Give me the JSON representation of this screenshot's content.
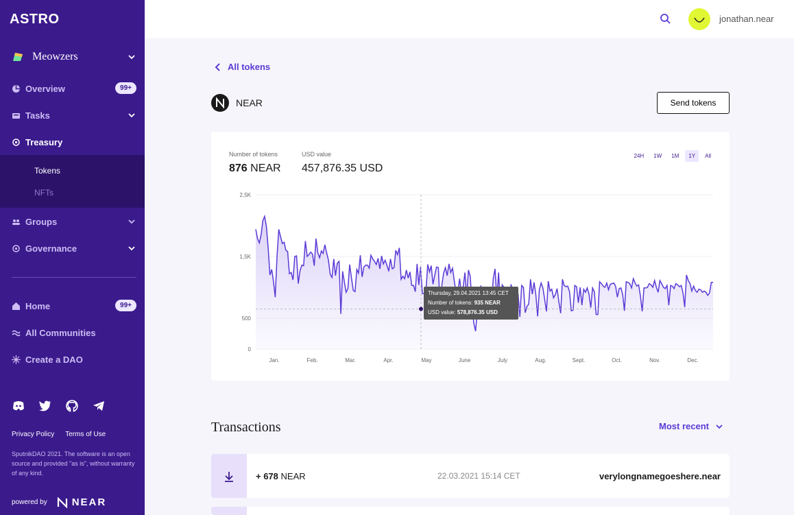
{
  "app": {
    "logo": "ASTRO"
  },
  "sidebar": {
    "dao_name": "Meowzers",
    "nav": {
      "overview": "Overview",
      "overview_badge": "99+",
      "tasks": "Tasks",
      "treasury": "Treasury",
      "groups": "Groups",
      "governance": "Governance",
      "home": "Home",
      "home_badge": "99+",
      "all_communities": "All Communities",
      "create_dao": "Create a DAO"
    },
    "sub": {
      "tokens": "Tokens",
      "nfts": "NFTs"
    },
    "footer": {
      "privacy": "Privacy Policy",
      "terms": "Terms of Use",
      "legal": "SputnikDAO 2021. The software is an open source and provided \"as is\", without warranty of any kind.",
      "powered_by": "powered by",
      "near_logo": "NEAR"
    }
  },
  "topbar": {
    "username": "jonathan.near"
  },
  "main": {
    "back_label": "All tokens",
    "token_name": "NEAR",
    "send_button": "Send tokens",
    "stats": {
      "tokens_label": "Number of tokens",
      "tokens_value": "876",
      "tokens_unit": "NEAR",
      "usd_label": "USD value",
      "usd_value": "457,876.35 USD"
    },
    "ranges": [
      "24H",
      "1W",
      "1M",
      "1Y",
      "All"
    ],
    "selected_range": "1Y",
    "transactions_title": "Transactions",
    "sort_label": "Most recent",
    "transactions": [
      {
        "amount_sign": "+ 678",
        "amount_unit": "NEAR",
        "date": "22.03.2021 15:14 CET",
        "account": "verylongnamegoeshere.near"
      }
    ]
  },
  "chart_data": {
    "type": "area",
    "ylim": [
      0,
      2500
    ],
    "yticks": [
      "0",
      "500",
      "1,5K",
      "2,5K"
    ],
    "ytick_values": [
      0,
      500,
      1500,
      2500
    ],
    "xtick_labels": [
      "Jan.",
      "Feb.",
      "Mar.",
      "Apr.",
      "May",
      "June",
      "July",
      "Aug.",
      "Sept.",
      "Oct.",
      "Nov.",
      "Dec."
    ],
    "values": [
      1940,
      1790,
      1720,
      1850,
      2080,
      2150,
      1990,
      1640,
      1200,
      1290,
      1090,
      840,
      1500,
      1940,
      1820,
      1710,
      1730,
      1600,
      1580,
      1220,
      1240,
      1120,
      1500,
      1510,
      1060,
      1270,
      1360,
      1350,
      1750,
      1500,
      1530,
      1570,
      1540,
      1350,
      1790,
      1560,
      1480,
      1590,
      1550,
      1690,
      1560,
      1440,
      1210,
      1160,
      1460,
      1190,
      1390,
      1420,
      570,
      1260,
      1080,
      920,
      980,
      1370,
      1150,
      950,
      930,
      1290,
      1230,
      1520,
      1170,
      1330,
      1360,
      1360,
      1310,
      1520,
      1460,
      1420,
      1370,
      1470,
      1300,
      1510,
      1380,
      1440,
      1360,
      1260,
      1460,
      1300,
      1320,
      1600,
      1530,
      1640,
      1130,
      1180,
      1140,
      1280,
      1150,
      1250,
      1030,
      1030,
      930,
      1380,
      1040,
      1330,
      900,
      900,
      930,
      1370,
      1250,
      1350,
      1050,
      1200,
      1330,
      1320,
      630,
      1040,
      1230,
      1320,
      1190,
      1380,
      1240,
      1310,
      1100,
      920,
      910,
      1140,
      920,
      1000,
      1240,
      850,
      1280,
      1180,
      720,
      420,
      290,
      640,
      660,
      1030,
      740,
      800,
      840,
      670,
      930,
      710,
      1140,
      1300,
      820,
      1240,
      650,
      1040,
      1000,
      950,
      770,
      500,
      1050,
      920,
      700,
      580,
      900,
      520,
      1030,
      1000,
      590,
      690,
      730,
      1130,
      890,
      1080,
      880,
      530,
      960,
      1070,
      990,
      800,
      610,
      1100,
      940,
      970,
      830,
      880,
      980,
      760,
      580,
      1130,
      1030,
      1010,
      1020,
      930,
      620,
      630,
      1030,
      1010,
      750,
      1000,
      710,
      970,
      920,
      990,
      890,
      670,
      990,
      930,
      560,
      560,
      1090,
      1060,
      1020,
      1000,
      1070,
      960,
      1050,
      1060,
      1070,
      1020,
      840,
      980,
      990,
      880,
      620,
      1090,
      1080,
      1060,
      990,
      1140,
      1070,
      1020,
      1040,
      860,
      610,
      990,
      990,
      1000,
      1060,
      1040,
      1000,
      1110,
      1000,
      920,
      1110,
      1060,
      1000,
      980,
      1030,
      710,
      1030,
      1020,
      980,
      1060,
      1040,
      1010,
      1030,
      910,
      680,
      1200,
      1110,
      1060,
      940,
      1020,
      950,
      920,
      970,
      960,
      920,
      940,
      920,
      870,
      910,
      1080,
      1080
    ],
    "average": 650,
    "tooltip": {
      "date": "Thursday, 29.04.2021 13:45 CET",
      "tokens_label": "Number of tokens:",
      "tokens_value": "935 NEAR",
      "usd_label": "USD value:",
      "usd_value": "578,876.35 USD"
    },
    "marker_value": 650,
    "colors": {
      "line": "#5b3ad6",
      "fill": "#d9d0f7"
    }
  }
}
